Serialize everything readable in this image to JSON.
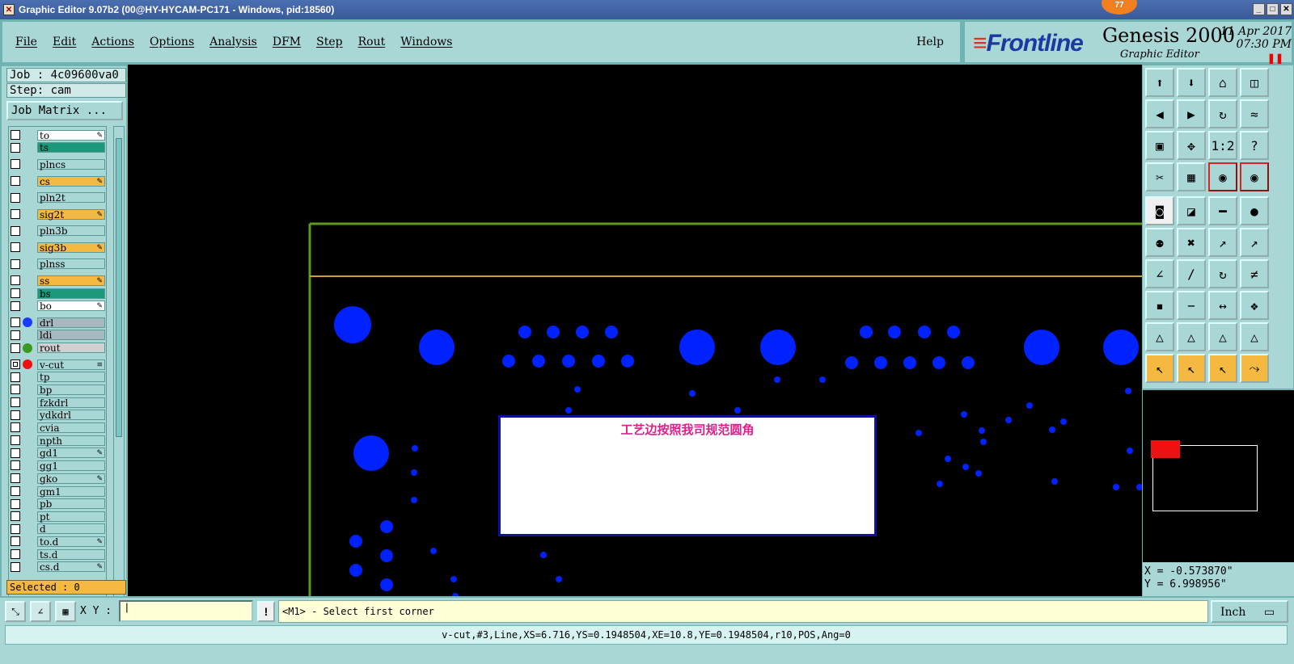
{
  "window": {
    "title": "Graphic Editor 9.07b2 (00@HY-HYCAM-PC171 - Windows, pid:18560)",
    "badge": "77"
  },
  "menu": {
    "items": [
      "File",
      "Edit",
      "Actions",
      "Options",
      "Analysis",
      "DFM",
      "Step",
      "Rout",
      "Windows"
    ],
    "help": "Help"
  },
  "brand": {
    "logo": "Frontline",
    "product": "Genesis 2000",
    "subtitle": "Graphic Editor",
    "date": "11 Apr 2017",
    "time": "07:30 PM"
  },
  "job": {
    "job_label": "Job : 4c09600va0",
    "step_label": "Step: cam",
    "matrix_button": "Job Matrix ..."
  },
  "layers": [
    {
      "name": "to",
      "bg": "#ffffff",
      "mark": "✎"
    },
    {
      "name": "ts",
      "bg": "#1a9a7a",
      "mark": ""
    },
    {
      "name": "plncs",
      "bg": "#a9d7d6",
      "mark": ""
    },
    {
      "name": "cs",
      "bg": "#f5b840",
      "mark": "✎"
    },
    {
      "name": "pln2t",
      "bg": "#a9d7d6",
      "mark": ""
    },
    {
      "name": "sig2t",
      "bg": "#f5b840",
      "mark": "✎"
    },
    {
      "name": "pln3b",
      "bg": "#a9d7d6",
      "mark": ""
    },
    {
      "name": "sig3b",
      "bg": "#f5b840",
      "mark": "✎"
    },
    {
      "name": "plnss",
      "bg": "#a9d7d6",
      "mark": ""
    },
    {
      "name": "ss",
      "bg": "#f5b840",
      "mark": "✎"
    },
    {
      "name": "bs",
      "bg": "#1a9a7a",
      "mark": ""
    },
    {
      "name": "bo",
      "bg": "#ffffff",
      "mark": "✎"
    },
    {
      "name": "drl",
      "bg": "#a8b8c0",
      "mark": "",
      "dot": "#1a3aff"
    },
    {
      "name": "ldi",
      "bg": "#a8b8c0",
      "mark": ""
    },
    {
      "name": "rout",
      "bg": "#d0d0d0",
      "mark": "",
      "dot": "#3a9a20"
    },
    {
      "name": "v-cut",
      "bg": "#a9d7d6",
      "mark": "≡",
      "dot": "#ee1111",
      "checked": true
    },
    {
      "name": "tp",
      "bg": "#a9d7d6",
      "mark": ""
    },
    {
      "name": "bp",
      "bg": "#a9d7d6",
      "mark": ""
    },
    {
      "name": "fzkdrl",
      "bg": "#a9d7d6",
      "mark": ""
    },
    {
      "name": "ydkdrl",
      "bg": "#a9d7d6",
      "mark": ""
    },
    {
      "name": "cvia",
      "bg": "#a9d7d6",
      "mark": ""
    },
    {
      "name": "npth",
      "bg": "#a9d7d6",
      "mark": ""
    },
    {
      "name": "gd1",
      "bg": "#a9d7d6",
      "mark": "✎"
    },
    {
      "name": "gg1",
      "bg": "#a9d7d6",
      "mark": ""
    },
    {
      "name": "gko",
      "bg": "#a9d7d6",
      "mark": "✎"
    },
    {
      "name": "gm1",
      "bg": "#a9d7d6",
      "mark": ""
    },
    {
      "name": "pb",
      "bg": "#a9d7d6",
      "mark": ""
    },
    {
      "name": "pt",
      "bg": "#a9d7d6",
      "mark": ""
    },
    {
      "name": "d",
      "bg": "#a9d7d6",
      "mark": ""
    },
    {
      "name": "to.d",
      "bg": "#a9d7d6",
      "mark": "✎"
    },
    {
      "name": "ts.d",
      "bg": "#a9d7d6",
      "mark": ""
    },
    {
      "name": "cs.d",
      "bg": "#a9d7d6",
      "mark": "✎"
    }
  ],
  "selected": "Selected : 0",
  "canvas": {
    "note_text": "工艺边按照我司规范圆角",
    "colors": {
      "pad": "#0022ff",
      "frame_green": "#5a9a20",
      "frame_gold": "#c8a040",
      "note_text": "#e0208a"
    }
  },
  "coords": {
    "x": "X = -0.573870\"",
    "y": "Y = 6.998956\""
  },
  "bottom": {
    "xy_label": "X Y :",
    "excl": "!",
    "prompt": "<M1> - Select first corner",
    "units": "Inch"
  },
  "status": "v-cut,#3,Line,XS=6.716,YS=0.1948504,XE=10.8,YE=0.1948504,r10,POS,Ang=0",
  "toolbar": [
    "open-icon",
    "save-icon",
    "home-icon",
    "window-icon",
    "prev-icon",
    "next-icon",
    "undo-icon",
    "snap-icon",
    "fit-icon",
    "zoom-icon",
    "ratio-icon",
    "help-icon",
    "measure-icon",
    "grid-icon",
    "layer-icon",
    "layer2-icon",
    "pad-icon",
    "edit-icon",
    "ruler-icon",
    "circle-icon",
    "move-icon",
    "cross-icon",
    "arrow-icon",
    "arrow2-icon",
    "angle-icon",
    "line-icon",
    "rotate-icon",
    "mirror-icon",
    "select-icon",
    "minus-icon",
    "resize-icon",
    "group-icon",
    "tri-icon",
    "tri2-icon",
    "tri3-icon",
    "tri4-icon",
    "pointer-icon",
    "pointer2-icon",
    "pointer3-icon",
    "route-icon"
  ],
  "toolbar_glyphs": [
    "⬆",
    "⬇",
    "⌂",
    "◫",
    "◀",
    "▶",
    "↻",
    "≈",
    "▣",
    "✥",
    "1:2",
    "?",
    "✂",
    "▦",
    "◉",
    "◉",
    "◙",
    "◪",
    "━",
    "●",
    "⚉",
    "✖",
    "↗",
    "↗",
    "∠",
    "∕",
    "↻",
    "≠",
    "▪",
    "−",
    "↔",
    "❖",
    "△",
    "△",
    "△",
    "△",
    "↖",
    "↖",
    "↖",
    "⤳"
  ]
}
